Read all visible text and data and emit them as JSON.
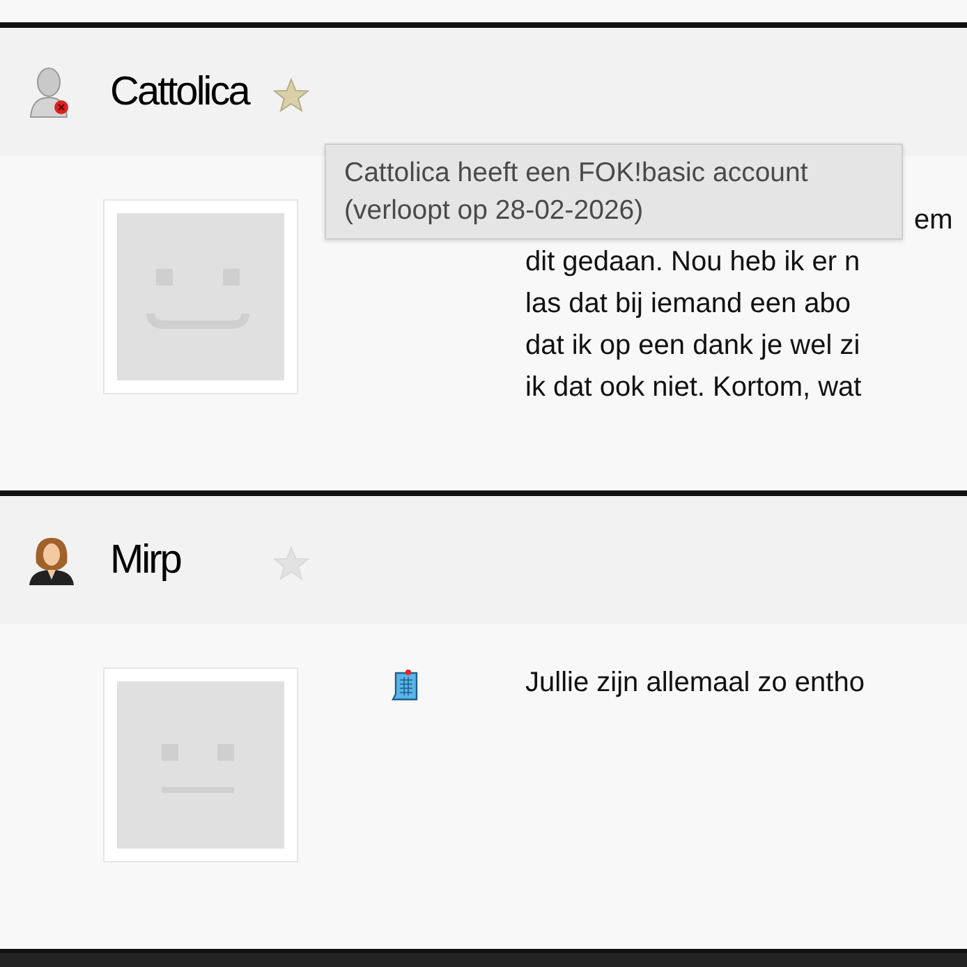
{
  "posts": [
    {
      "author": "Cattolica",
      "user_icon": {
        "kind": "anonymous"
      },
      "fok_basic": true,
      "avatar": {
        "kind": "smile"
      },
      "show_post_icon": false,
      "lines": [
        "em",
        "dit gedaan. Nou heb ik er n",
        "las dat bij iemand een abo",
        "dat ik op een dank je wel zi",
        "ik dat ook niet. Kortom, wat"
      ],
      "first_line_covered": true
    },
    {
      "author": "Mirp",
      "user_icon": {
        "kind": "woman"
      },
      "fok_basic": false,
      "avatar": {
        "kind": "neutral"
      },
      "show_post_icon": true,
      "lines": [
        "Jullie zijn allemaal zo entho"
      ],
      "first_line_covered": false
    }
  ],
  "tooltip": {
    "lines": [
      "Cattolica heeft een FOK!basic account",
      "(verloopt op 28-02-2026)"
    ]
  }
}
